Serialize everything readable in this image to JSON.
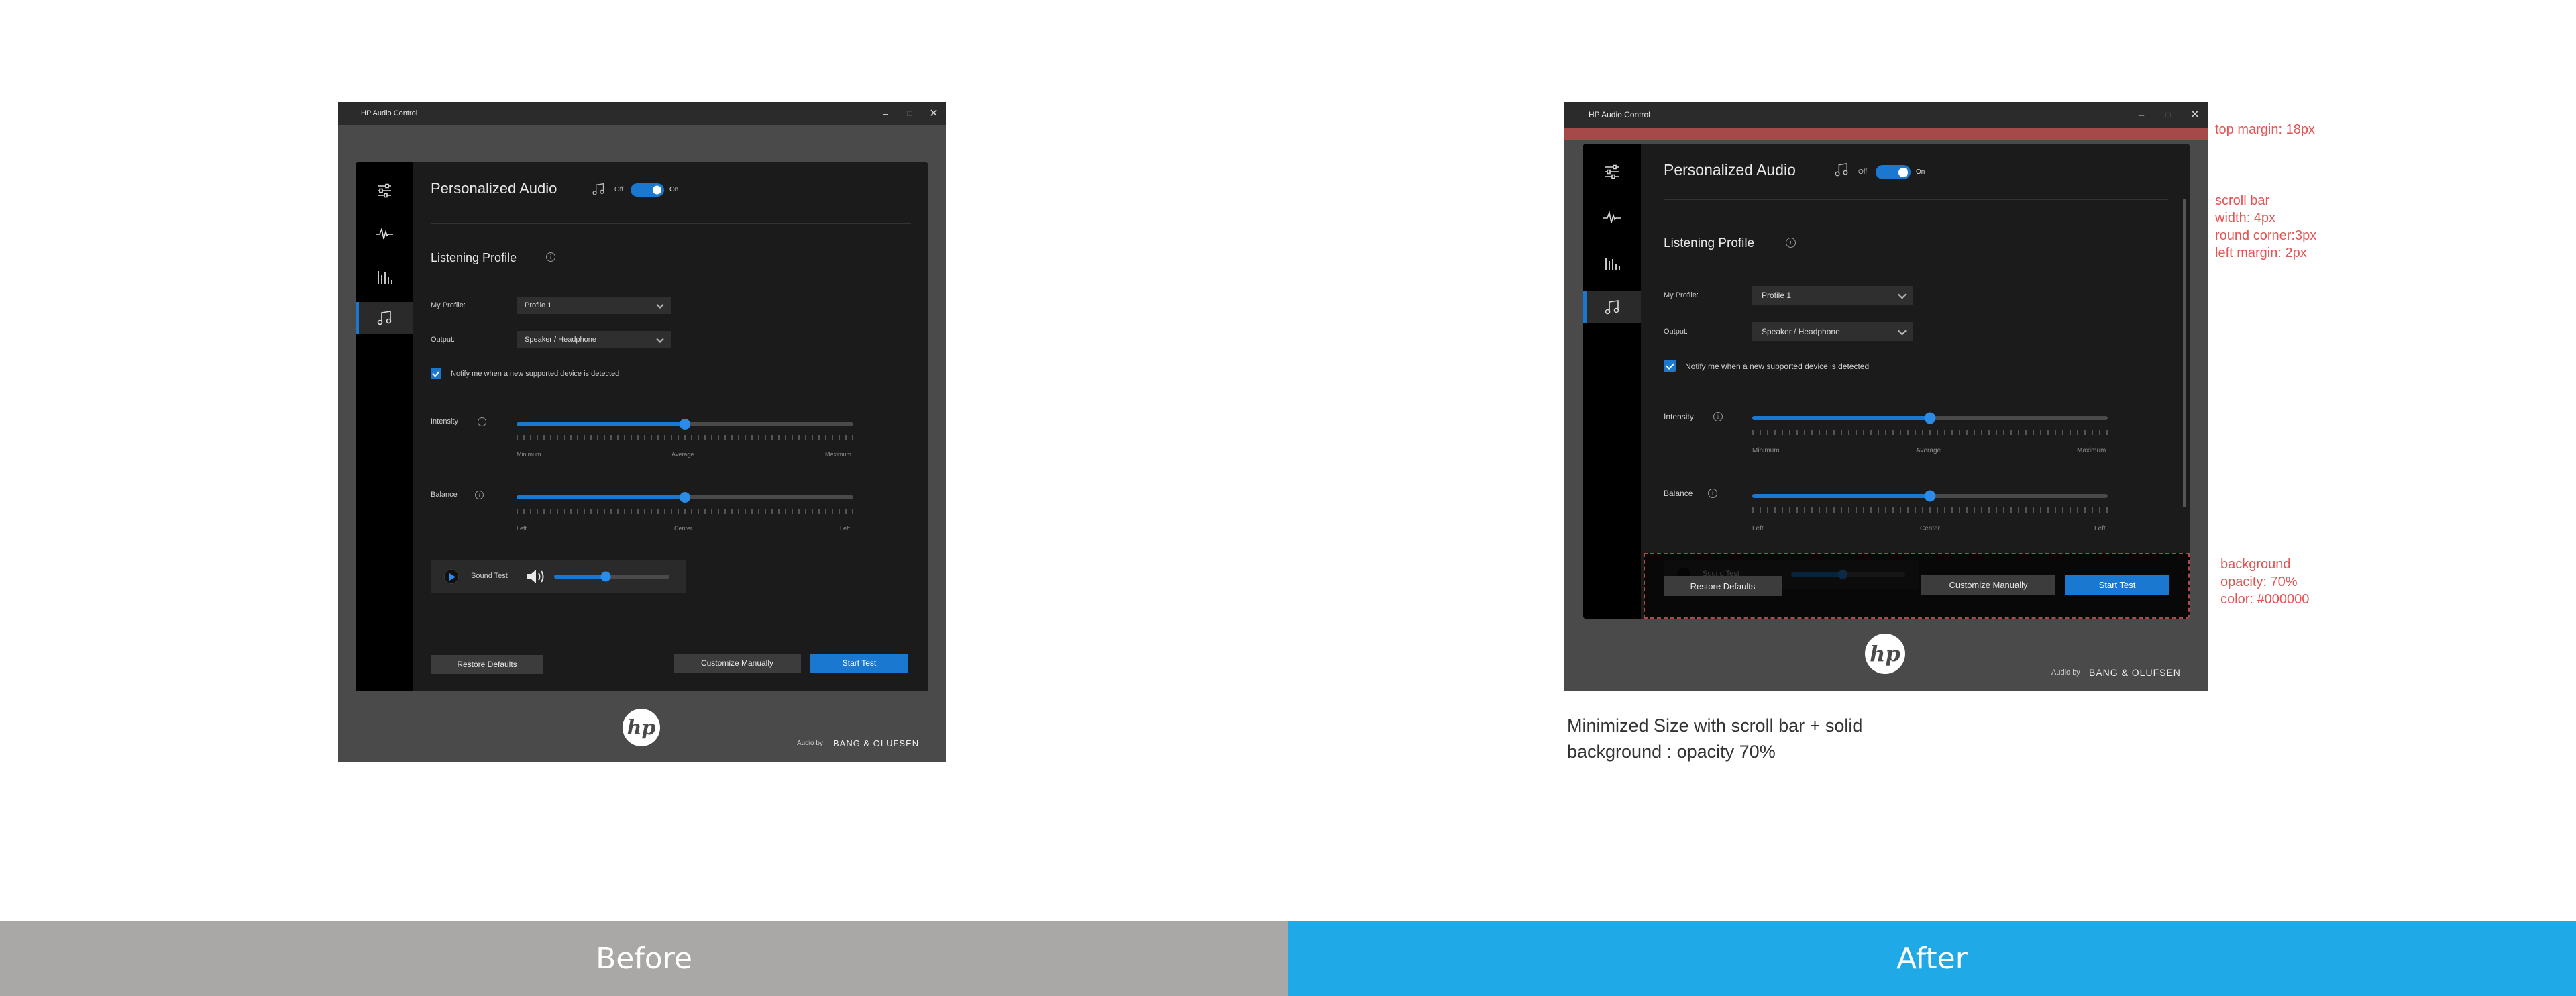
{
  "colors": {
    "accent": "#1a78d1",
    "before_bar": "#a9a8a6",
    "after_bar": "#1fa9e6",
    "annotation": "#e55353"
  },
  "app": {
    "window_title": "HP Audio Control",
    "minimize": "–",
    "maximize": "□",
    "close": "✕",
    "rail_icons": [
      "sliders-icon",
      "waveform-icon",
      "equalizer-icon",
      "music-note-icon"
    ],
    "header_title": "Personalized Audio",
    "toggle_off": "Off",
    "toggle_on": "On",
    "toggle_state": "on",
    "section_title": "Listening Profile",
    "info_glyph": "i",
    "my_profile_label": "My Profile:",
    "my_profile_value": "Profile 1",
    "output_label": "Output:",
    "output_value": "Speaker / Headphone",
    "notify_checked": true,
    "notify_label": "Notify me when a new supported device is detected",
    "intensity_label": "Intensity",
    "intensity_value_pct": 50,
    "intensity_ticks": [
      "Minimum",
      "Average",
      "Maximum"
    ],
    "balance_label": "Balance",
    "balance_value_pct": 50,
    "balance_ticks_before": [
      "Left",
      "Center",
      "Left"
    ],
    "balance_ticks_after": [
      "Left",
      "Center",
      "Left"
    ],
    "sound_test_label": "Sound Test",
    "sound_test_volume_pct": 45,
    "restore_defaults": "Restore Defaults",
    "customize_manually": "Customize Manually",
    "start_test": "Start Test",
    "hp_logo": "hp",
    "audio_by": "Audio by",
    "brand": "BANG & OLUFSEN"
  },
  "annotations": {
    "top_margin": "top margin: 18px",
    "scroll_bar": [
      "scroll bar",
      "width: 4px",
      "round corner:3px",
      "left margin: 2px"
    ],
    "background": [
      "background",
      "opacity: 70%",
      "color: #000000"
    ],
    "caption_line1": "Minimized Size with scroll bar + solid",
    "caption_line2": "background : opacity 70%"
  },
  "bars": {
    "before": "Before",
    "after": "After"
  }
}
